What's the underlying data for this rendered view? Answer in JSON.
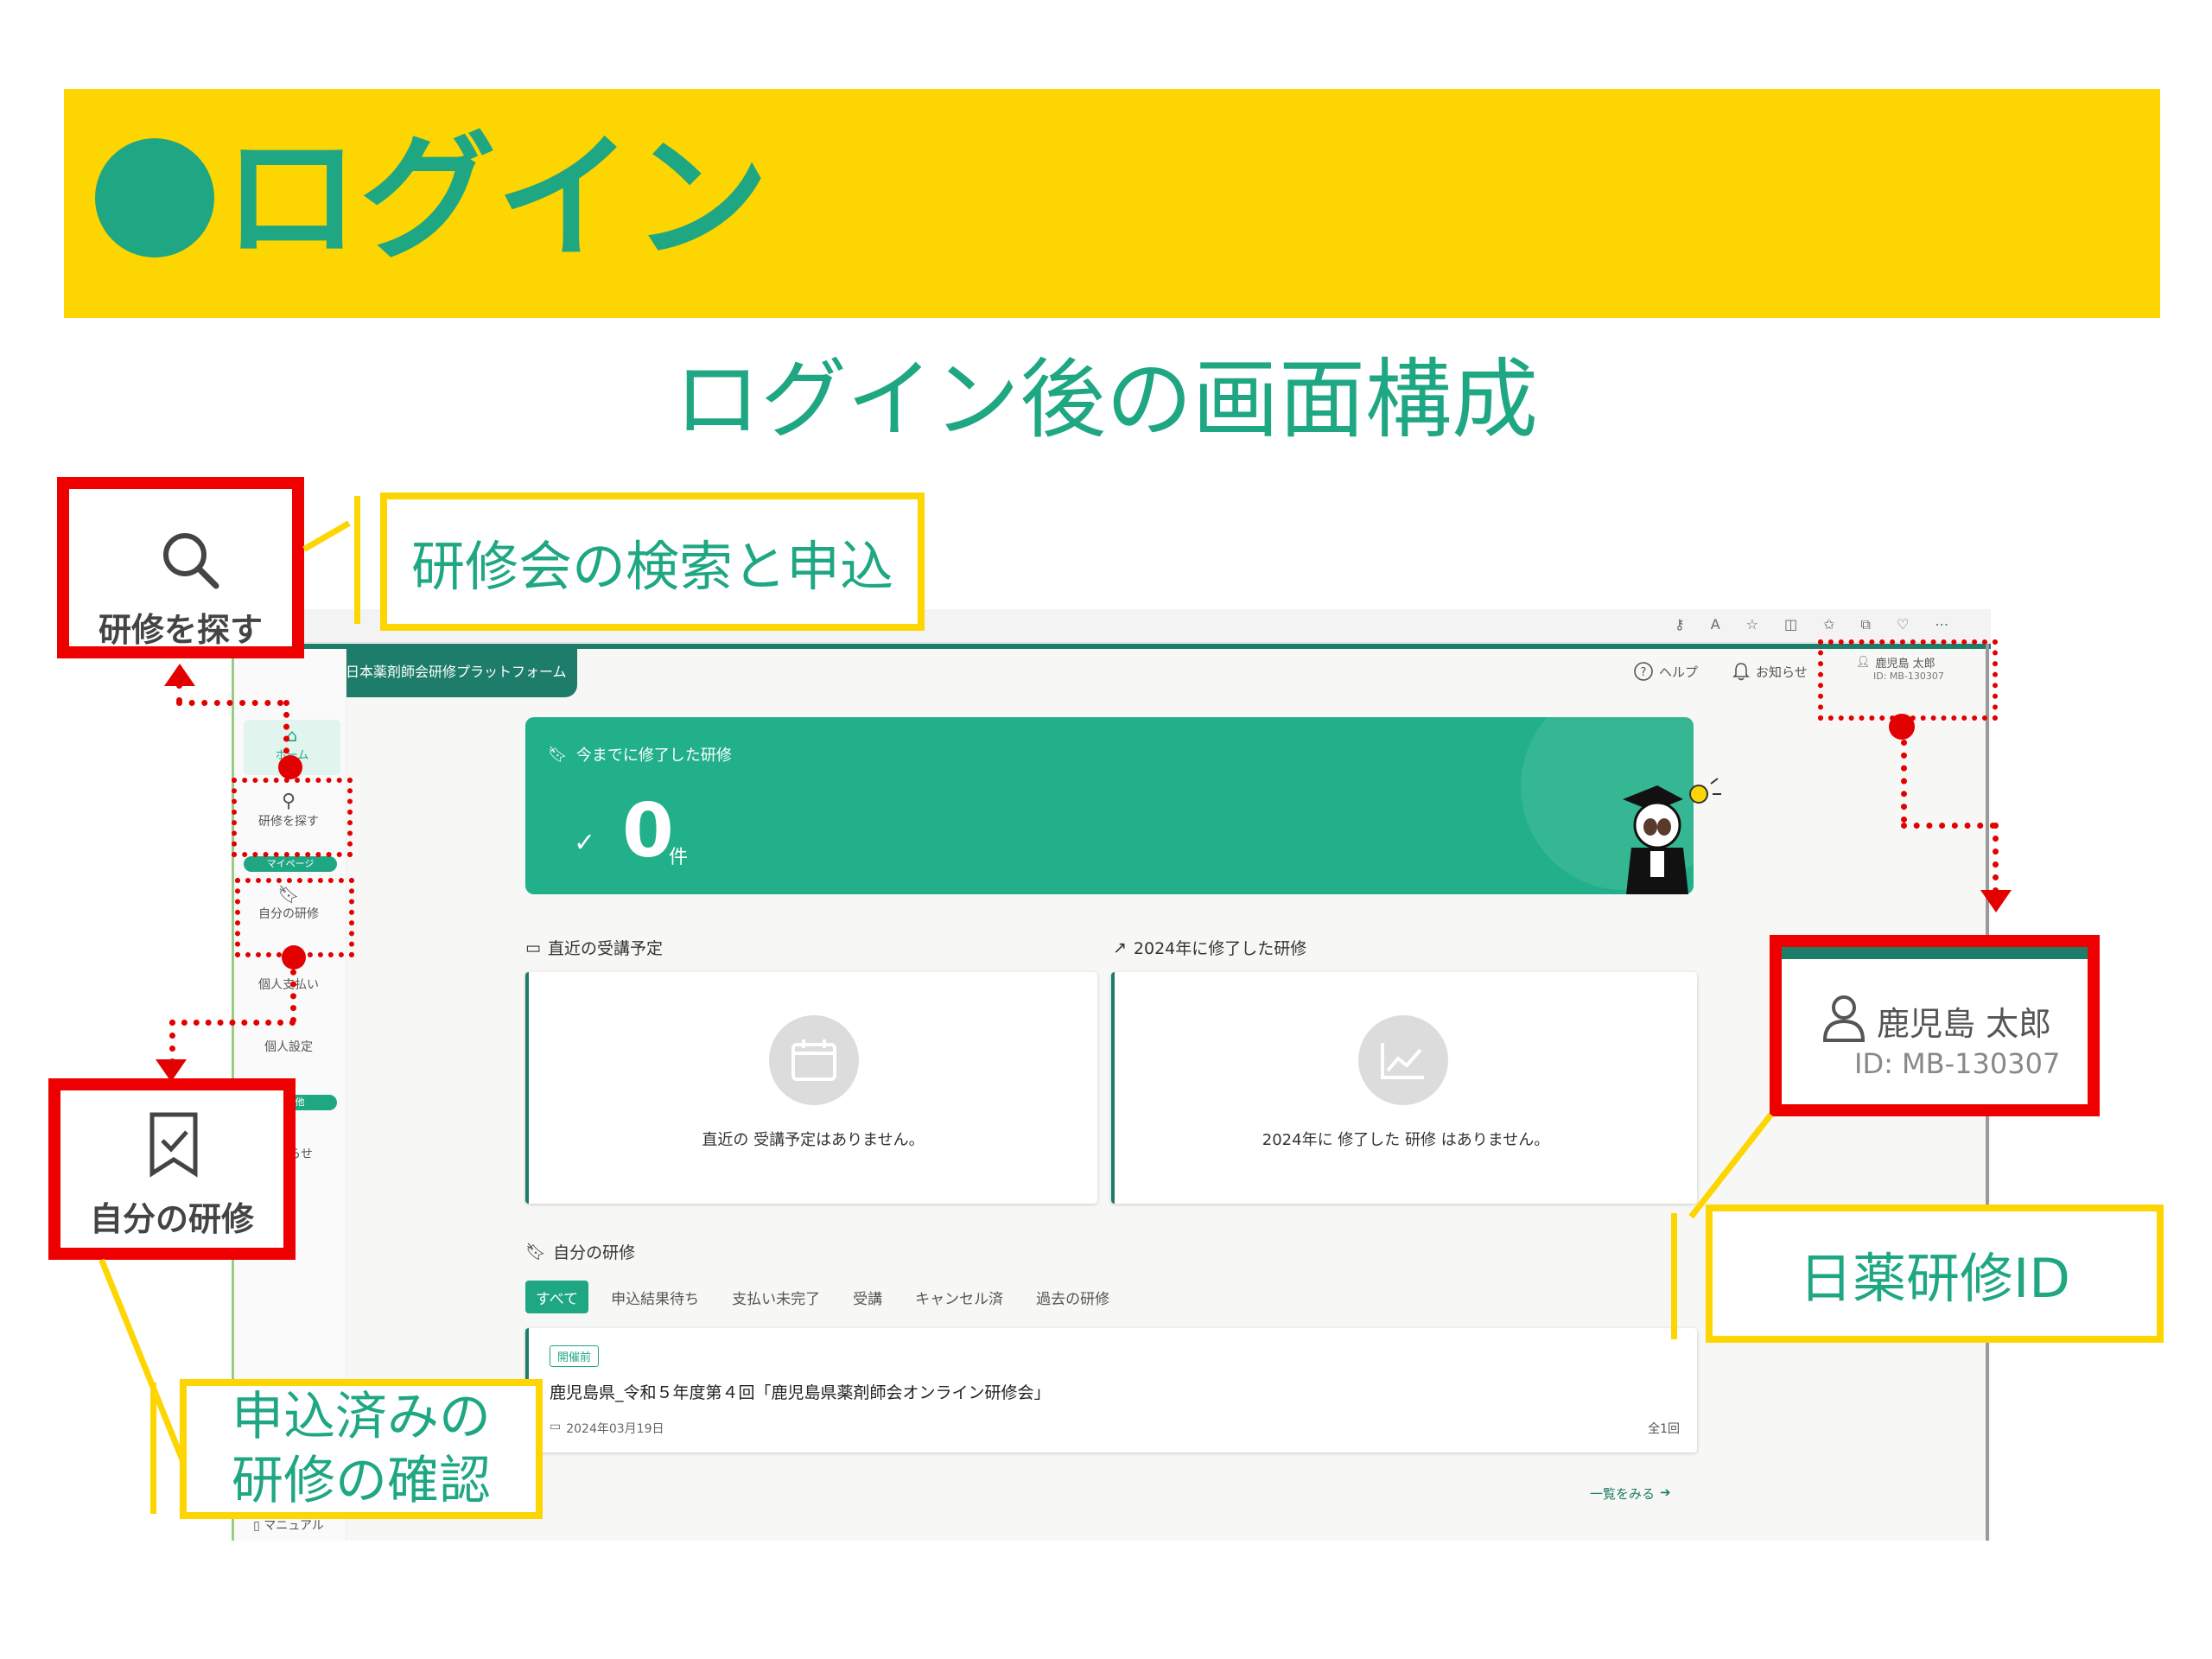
{
  "slide": {
    "title": "ログイン",
    "subtitle": "ログイン後の画面構成"
  },
  "callouts": {
    "search_box_label": "研修を探す",
    "search_desc": "研修会の検索と申込",
    "my_training_box_label": "自分の研修",
    "my_training_desc_line1": "申込済みの",
    "my_training_desc_line2": "研修の確認",
    "user_box_name": "鹿児島 太郎",
    "user_box_id": "ID: MB-130307",
    "user_desc": "日薬研修ID"
  },
  "app": {
    "platform_title": "日本薬剤師会研修プラットフォーム",
    "header": {
      "help": "ヘルプ",
      "notifications": "お知らせ",
      "user_name": "鹿児島 太郎",
      "user_id": "ID: MB-130307"
    },
    "sidebar": {
      "home": "ホーム",
      "search": "研修を探す",
      "mypage_badge": "マイページ",
      "my_training": "自分の研修",
      "payment": "個人支払い",
      "settings": "個人設定",
      "other_badge": "その他",
      "notice": "お知らせ",
      "manual": "マニュアル"
    },
    "hero": {
      "title": "今までに修了した研修",
      "count": "0",
      "unit": "件"
    },
    "upcoming": {
      "title": "直近の受講予定",
      "empty": "直近の 受講予定はありません。"
    },
    "completed": {
      "title": "2024年に修了した研修",
      "empty": "2024年に 修了した 研修 はありません。"
    },
    "my_training": {
      "title": "自分の研修",
      "tabs": [
        "すべて",
        "申込結果待ち",
        "支払い未完了",
        "受講",
        "キャンセル済",
        "過去の研修"
      ],
      "item": {
        "status": "開催前",
        "name": "鹿児島県_令和５年度第４回「鹿児島県薬剤師会オンライン研修会」",
        "date": "2024年03月19日",
        "sessions": "全1回"
      },
      "see_all": "一覧をみる"
    }
  },
  "colors": {
    "brand_green": "#1FA784",
    "dark_green": "#1E7D6A",
    "banner_yellow": "#FDD500",
    "highlight_red": "#EE0000"
  }
}
